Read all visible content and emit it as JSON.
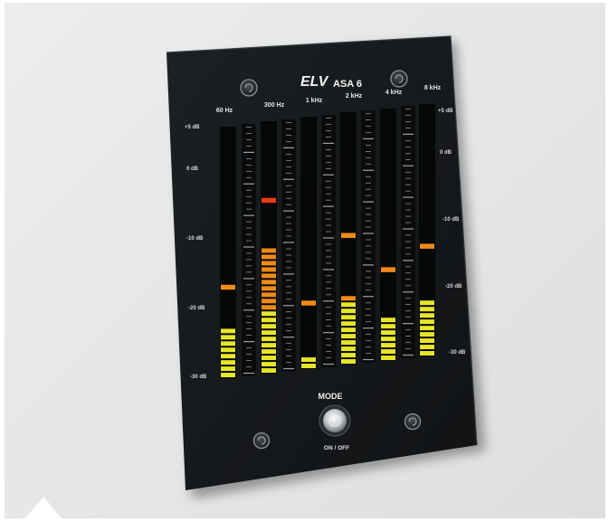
{
  "device": {
    "brand": "ELV",
    "model": "ASA 6",
    "mode_label": "MODE",
    "power_label": "ON / OFF"
  },
  "bands": [
    {
      "label": "60 Hz",
      "level_segments": 8,
      "peak_segment": 14
    },
    {
      "label": "300 Hz",
      "level_segments": 20,
      "peak_segment": 27
    },
    {
      "label": "1 kHz",
      "level_segments": 2,
      "peak_segment": 10
    },
    {
      "label": "2 kHz",
      "level_segments": 11,
      "peak_segment": 20
    },
    {
      "label": "4 kHz",
      "level_segments": 7,
      "peak_segment": 14
    },
    {
      "label": "8 kHz",
      "level_segments": 9,
      "peak_segment": 17
    }
  ],
  "scale_left": [
    "+5 dB",
    "0 dB",
    "-10 dB",
    "-20 dB",
    "-30 dB"
  ],
  "scale_right": [
    "+5 dB",
    "0 dB",
    "-10 dB",
    "-20 dB",
    "-30 dB"
  ],
  "colors": {
    "panel": "#16191b",
    "yellow": "#e6e629",
    "orange": "#f08a17",
    "red": "#e83a18"
  }
}
